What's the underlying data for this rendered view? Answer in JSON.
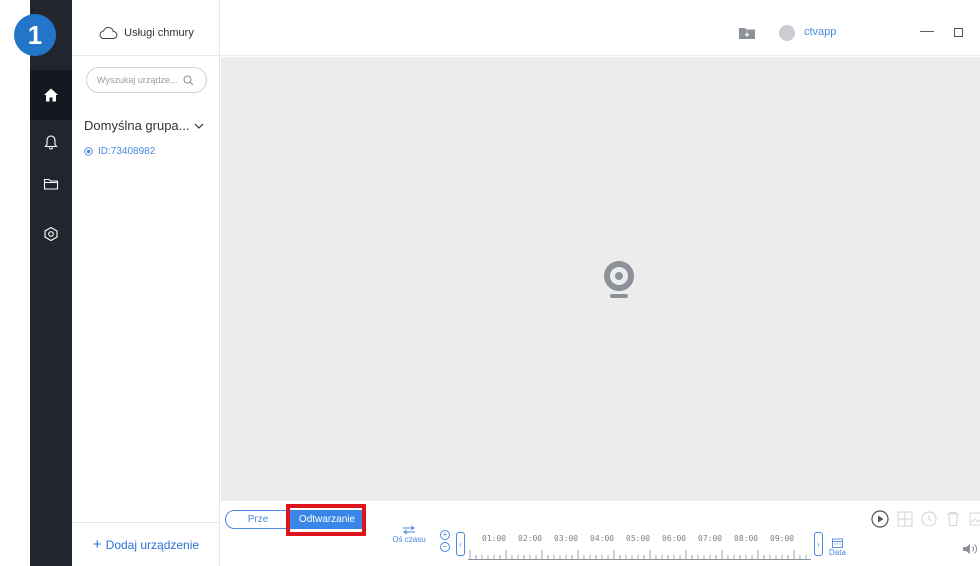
{
  "step_badge": "1",
  "sidebar": {
    "icons": [
      "home-icon",
      "bell-icon",
      "folder-icon",
      "settings-icon"
    ]
  },
  "device_panel": {
    "cloud_button_label": "Usługi chmury",
    "search_placeholder": "Wyszukaj urządze...",
    "group_name": "Domyślna grupa...",
    "device_id": "ID:73408982",
    "add_device_label": "Dodaj urządzenie",
    "add_device_plus": "+"
  },
  "header": {
    "username": "ctvapp",
    "minimize_glyph": "—"
  },
  "controls": {
    "tab_live_label": "Prze",
    "tab_playback_label": "Odtwarzanie",
    "timeline_toggle_label": "Oś czasu",
    "date_button_label": "Data",
    "timeline_labels": [
      "01:00",
      "02:00",
      "03:00",
      "04:00",
      "05:00",
      "06:00",
      "07:00",
      "08:00",
      "09:00"
    ]
  },
  "colors": {
    "accent": "#3a86e8",
    "rail": "#21262e",
    "highlight": "#e0121c",
    "video_bg": "#ececec"
  }
}
